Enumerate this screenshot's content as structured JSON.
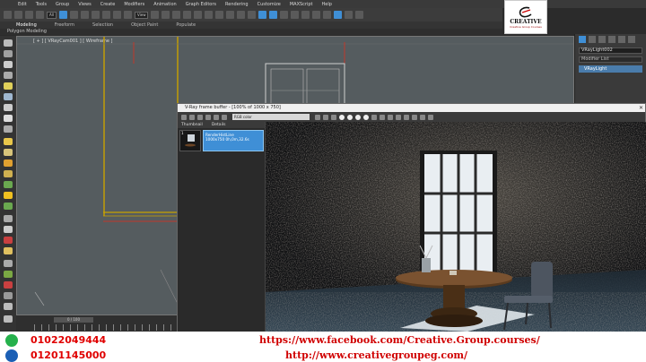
{
  "menu": [
    "Edit",
    "Tools",
    "Group",
    "Views",
    "Create",
    "Modifiers",
    "Animation",
    "Graph Editors",
    "Rendering",
    "Customize",
    "MAXScript",
    "Help"
  ],
  "toolbar": {
    "selection_filter": "All",
    "view_dropdown": "View"
  },
  "ribbon": {
    "tabs": [
      "Modeling",
      "Freeform",
      "Selection",
      "Object Paint",
      "Populate"
    ],
    "active": "Modeling",
    "subtitle": "Polygon Modeling"
  },
  "logo": {
    "name": "CREATIVE",
    "sub": "Creative Group Courses"
  },
  "viewport": {
    "label": "[ + ] [ VRayCam001 ] [ Wireframe ]"
  },
  "command_panel": {
    "object_name": "VRayLight002",
    "modifier_list": "Modifier List",
    "stack_item": "VRayLight"
  },
  "timeline": {
    "frame": "0 / 100"
  },
  "vfb": {
    "title": "V-Ray frame buffer - [100% of 1000 x 750]",
    "close": "✕",
    "channel": "RGB color",
    "history_headers": [
      "Thumbnail",
      "Details"
    ],
    "history_item": {
      "number": "1",
      "details": "RenderHistLine\n1000x750 0h,0m,32.6s"
    }
  },
  "footer": {
    "phone1": "01022049444",
    "phone2": "01201145000",
    "facebook": "https://www.facebook.com/Creative.Group.courses/",
    "website": "http://www.creativegroupeg.com/"
  },
  "colors": {
    "accent": "#3f8fd6",
    "footer_text": "#d00000",
    "whatsapp": "#25b14c"
  }
}
